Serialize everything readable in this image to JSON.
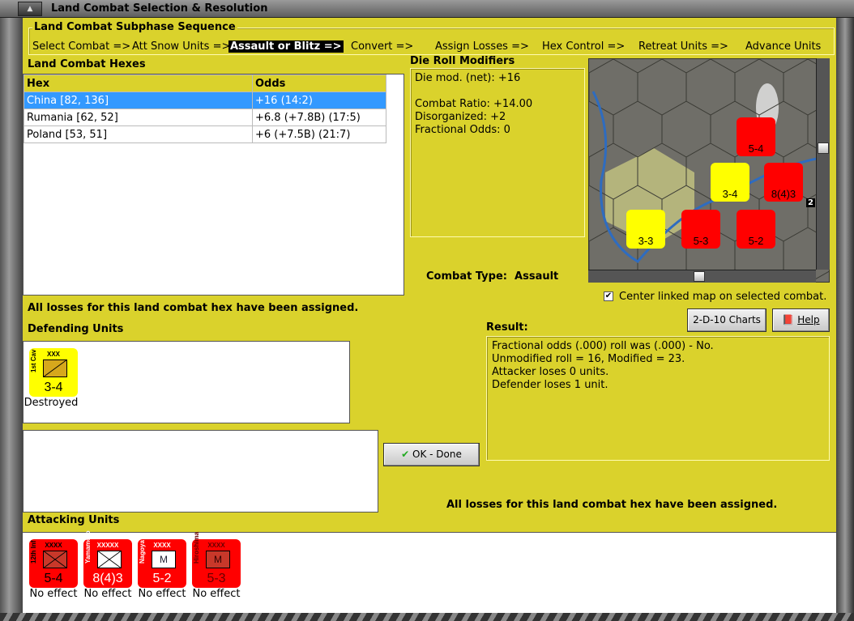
{
  "window": {
    "title": "Land Combat Selection & Resolution"
  },
  "subphase": {
    "title": "Land Combat Subphase Sequence",
    "steps": [
      "Select Combat =>",
      "Att Snow Units =>",
      "Assault or Blitz =>",
      "Convert =>",
      "Assign Losses =>",
      "Hex Control =>",
      "Retreat Units =>",
      "Advance Units"
    ],
    "active_index": 2
  },
  "hexes": {
    "title": "Land Combat Hexes",
    "columns": [
      "Hex",
      "Odds"
    ],
    "rows": [
      [
        "China [82, 136]",
        "+16 (14:2)"
      ],
      [
        "Rumania [62, 52]",
        "+6.8 (+7.8B) (17:5)"
      ],
      [
        "Poland [53, 51]",
        "+6 (+7.5B) (21:7)"
      ]
    ],
    "selected": 0
  },
  "modifiers": {
    "title": "Die Roll Modifiers",
    "lines": [
      "Die mod. (net): +16",
      "",
      "Combat Ratio: +14.00",
      "Disorganized: +2",
      "Fractional Odds: 0"
    ]
  },
  "combat_type": {
    "label": "Combat Type:",
    "value": "Assault"
  },
  "map": {
    "center_linked_label": "Center linked map on selected combat.",
    "center_linked_checked": true,
    "stack_badge": "2"
  },
  "losses_msg_top": "All losses for this land combat hex have been assigned.",
  "buttons": {
    "charts": "2-D-10 Charts",
    "help": "Help",
    "ok": "OK - Done"
  },
  "defending": {
    "title": "Defending Units",
    "units": [
      {
        "name": "1st Cav",
        "size": "XXX",
        "strength": "3-4",
        "status": "Destroyed",
        "color": "#ffff00",
        "symbol": "cav"
      }
    ]
  },
  "result": {
    "title": "Result:",
    "lines": [
      "Fractional odds (.000) roll was (.000)  - No.",
      "Unmodified roll = 16, Modified = 23.",
      "Attacker loses 0 units.",
      "Defender loses 1 unit."
    ]
  },
  "losses_msg_bottom": "All losses for this land combat hex have been assigned.",
  "attacking": {
    "title": "Attacking Units",
    "units": [
      {
        "name": "12th Inf",
        "size": "XXXX",
        "strength": "5-4",
        "status": "No effect",
        "symbol": "inf",
        "box": "#c8382a"
      },
      {
        "name": "Yamamoto",
        "size": "XXXXX",
        "strength": "8(4)3",
        "status": "No effect",
        "symbol": "inf",
        "box": "#ffffff"
      },
      {
        "name": "Nagoya",
        "size": "XXXX",
        "strength": "5-2",
        "status": "No effect",
        "symbol": "mech",
        "box": "#ffffff",
        "mark": "M"
      },
      {
        "name": "Hiroshima",
        "size": "XXXX",
        "strength": "5-3",
        "status": "No effect",
        "symbol": "mech",
        "box": "#c8382a",
        "mark": "M"
      }
    ]
  }
}
